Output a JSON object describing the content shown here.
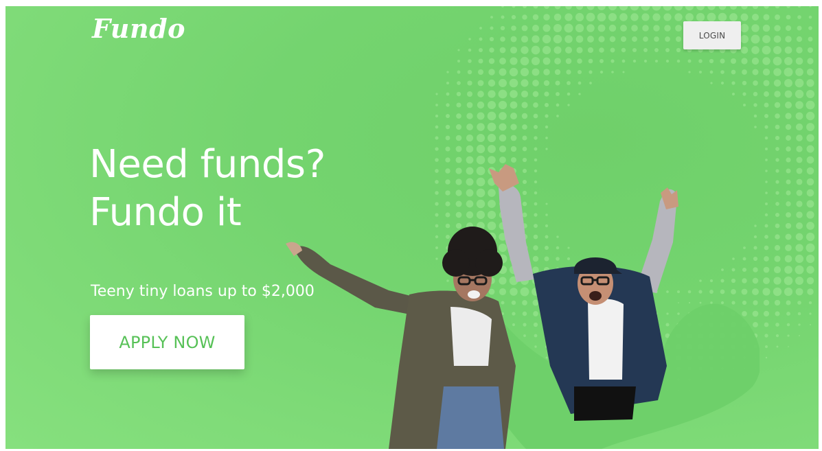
{
  "brand": {
    "logo_text": "Fundo"
  },
  "header": {
    "login_label": "LOGIN"
  },
  "hero": {
    "headline_line1": "Need funds?",
    "headline_line2": "Fundo it",
    "subline": "Teeny tiny loans up to $2,000",
    "cta_label": "APPLY NOW",
    "image_alt": "two-people-jumping-photo"
  },
  "colors": {
    "background": "#7ad873",
    "accent": "#57c157",
    "button_bg": "#efefef",
    "text": "#ffffff"
  }
}
